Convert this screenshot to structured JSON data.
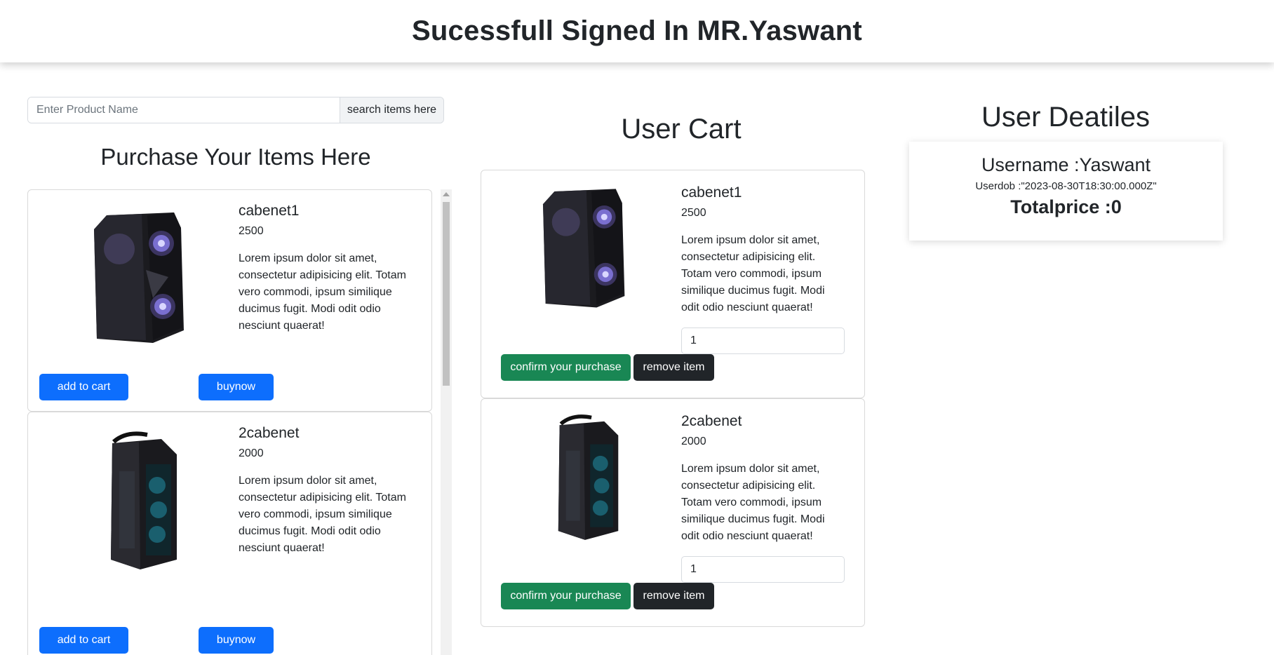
{
  "header": {
    "title": "Sucessfull Signed In MR.Yaswant"
  },
  "search": {
    "placeholder": "Enter Product Name",
    "button_label": "search items here"
  },
  "products_section": {
    "title": "Purchase Your Items Here",
    "items": [
      {
        "name": "cabenet1",
        "price": "2500",
        "description": "Lorem ipsum dolor sit amet, consectetur adipisicing elit. Totam vero commodi, ipsum similique ducimus fugit. Modi odit odio nesciunt quaerat!",
        "add_label": "add to cart",
        "buy_label": "buynow"
      },
      {
        "name": "2cabenet",
        "price": "2000",
        "description": "Lorem ipsum dolor sit amet, consectetur adipisicing elit. Totam vero commodi, ipsum similique ducimus fugit. Modi odit odio nesciunt quaerat!",
        "add_label": "add to cart",
        "buy_label": "buynow"
      }
    ]
  },
  "cart": {
    "title": "User Cart",
    "items": [
      {
        "name": "cabenet1",
        "price": "2500",
        "description": "Lorem ipsum dolor sit amet, consectetur adipisicing elit. Totam vero commodi, ipsum similique ducimus fugit. Modi odit odio nesciunt quaerat!",
        "quantity": "1",
        "confirm_label": "confirm your purchase",
        "remove_label": "remove item"
      },
      {
        "name": "2cabenet",
        "price": "2000",
        "description": "Lorem ipsum dolor sit amet, consectetur adipisicing elit. Totam vero commodi, ipsum similique ducimus fugit. Modi odit odio nesciunt quaerat!",
        "quantity": "1",
        "confirm_label": "confirm your purchase",
        "remove_label": "remove item"
      }
    ]
  },
  "user": {
    "title": "User Deatiles",
    "username": "Username :Yaswant",
    "dob": "Userdob :\"2023-08-30T18:30:00.000Z\"",
    "total": "Totalprice :0"
  },
  "colors": {
    "primary": "#0d6efd",
    "success": "#198754",
    "dark": "#212529"
  }
}
